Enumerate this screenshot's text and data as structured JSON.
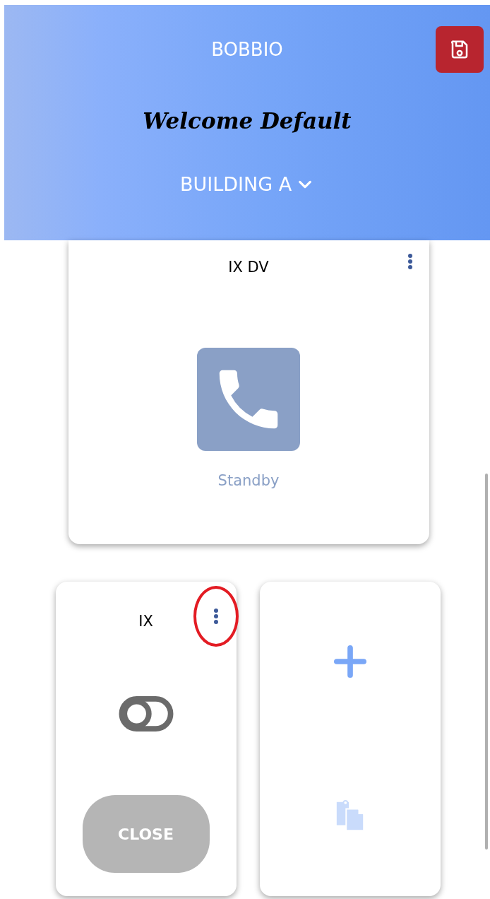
{
  "header": {
    "title": "BOBBIO",
    "welcome": "Welcome Default",
    "building": "BUILDING A"
  },
  "cards": [
    {
      "kind": "phone",
      "name": "IX DV",
      "status": "Standby",
      "menu_highlighted": false
    },
    {
      "kind": "switch",
      "name": "IX",
      "on": false,
      "button": {
        "label": "CLOSE",
        "disabled": true
      },
      "menu_highlighted": true
    },
    {
      "kind": "add"
    }
  ]
}
